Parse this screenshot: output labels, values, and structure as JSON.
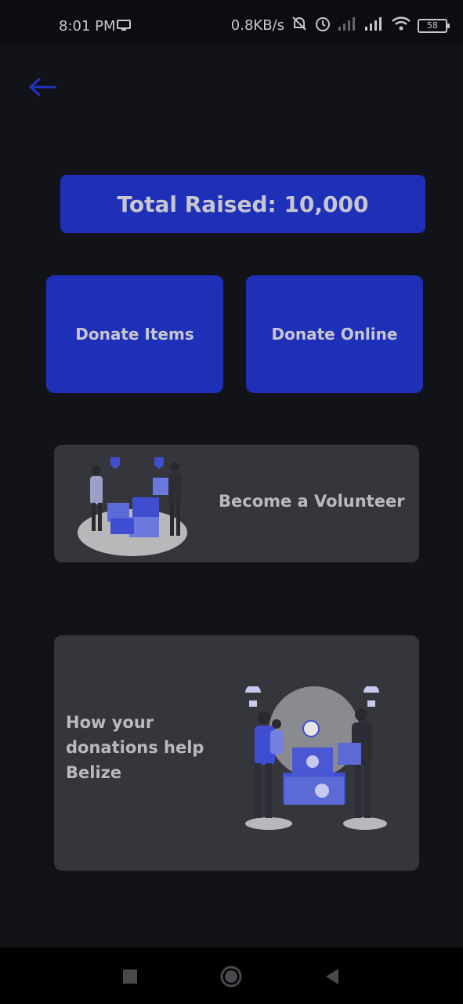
{
  "status_bar": {
    "time": "8:01 PM",
    "net_speed": "0.8KB/s",
    "battery": "58"
  },
  "icons": {
    "back": "back-arrow-icon",
    "monitor": "monitor-icon",
    "mute": "mute-bell-icon",
    "alarm": "alarm-icon",
    "signal": "signal-icon",
    "wifi": "wifi-icon",
    "battery": "battery-icon"
  },
  "colors": {
    "background": "#121318",
    "accent": "#1f30b8",
    "panel": "#35363c"
  },
  "main": {
    "total_raised": "Total Raised: 10,000",
    "donate_items": "Donate Items",
    "donate_online": "Donate Online",
    "volunteer": "Become a Volunteer",
    "how_help": "How your donations help Belize"
  }
}
